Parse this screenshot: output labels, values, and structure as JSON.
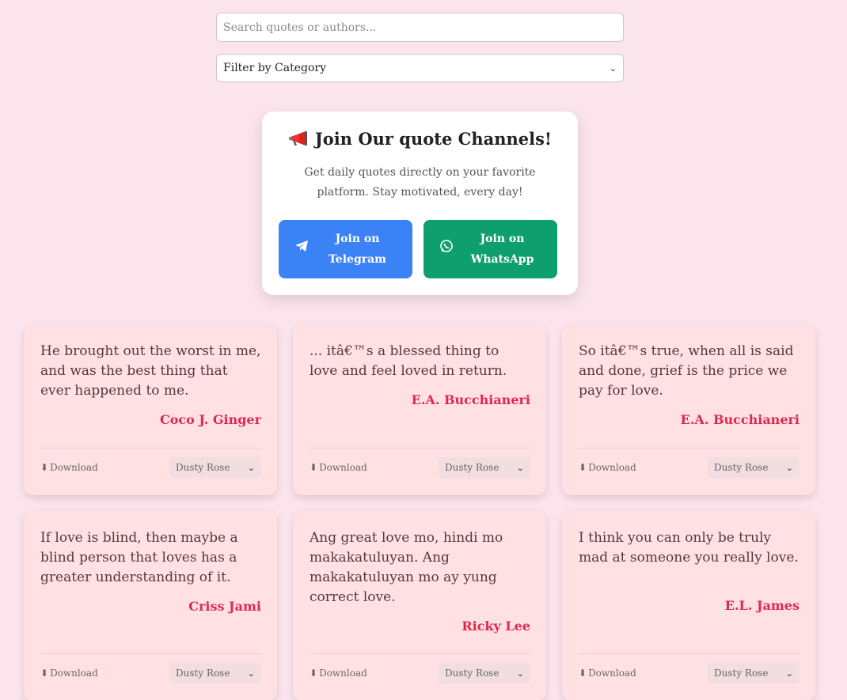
{
  "search": {
    "placeholder": "Search quotes or authors..."
  },
  "filter": {
    "selected": "Filter by Category"
  },
  "join": {
    "emoji": "📢",
    "title": "Join Our quote Channels!",
    "description": "Get daily quotes directly on your favorite platform. Stay motivated, every day!",
    "telegram_label": "Join on Telegram",
    "whatsapp_label": "Join on WhatsApp"
  },
  "colors": {
    "telegram": "#3b82f6",
    "whatsapp": "#0f9e6e",
    "author": "#e0284e",
    "background": "#fce4ec"
  },
  "icons": {
    "telegram": "paper-plane-icon",
    "whatsapp": "whatsapp-icon",
    "download": "download-arrow-icon"
  },
  "quotes": [
    {
      "text": "He brought out the worst in me, and was the best thing that ever happened to me.",
      "author": "Coco J. Ginger",
      "download": "Download",
      "theme": "Dusty Rose"
    },
    {
      "text": "... itâ€™s a blessed thing to love and feel loved in return.",
      "author": "E.A. Bucchianeri",
      "download": "Download",
      "theme": "Dusty Rose"
    },
    {
      "text": "So itâ€™s true, when all is said and done, grief is the price we pay for love.",
      "author": "E.A. Bucchianeri",
      "download": "Download",
      "theme": "Dusty Rose"
    },
    {
      "text": "If love is blind, then maybe a blind person that loves has a greater understanding of it.",
      "author": "Criss Jami",
      "download": "Download",
      "theme": "Dusty Rose"
    },
    {
      "text": "Ang great love mo, hindi mo makakatuluyan. Ang makakatuluyan mo ay yung correct love.",
      "author": "Ricky Lee",
      "download": "Download",
      "theme": "Dusty Rose"
    },
    {
      "text": "I think you can only be truly mad at someone you really love.",
      "author": "E.L. James",
      "download": "Download",
      "theme": "Dusty Rose"
    }
  ]
}
